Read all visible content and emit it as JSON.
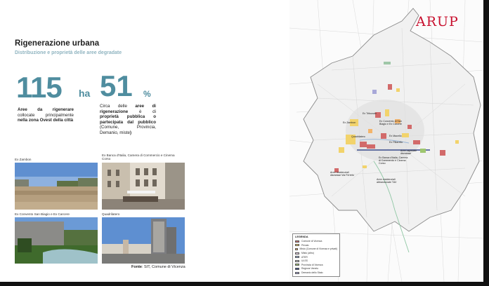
{
  "header": {
    "title": "Rigenerazione urbana",
    "subtitle": "Distribuzione e proprietà delle aree degradate"
  },
  "stats": {
    "area_value": "115",
    "area_unit": "ha",
    "area_desc_bold1": "Aree da rigenerare",
    "area_desc_plain": " collocate principalmente ",
    "area_desc_bold2": "nella zona Ovest della città",
    "pct_value": "51",
    "pct_unit": "%",
    "pct_desc_plain1": "Circa delle ",
    "pct_desc_bold1": "aree di rigenerazione",
    "pct_desc_plain2": " è di ",
    "pct_desc_bold2": "proprietà pubblica o partecipata dal pubblico",
    "pct_desc_plain3": " (Comune, Provincia, Demanio, miste",
    "pct_desc_close": ")"
  },
  "photos": [
    {
      "caption": "Ex Zambon"
    },
    {
      "caption": "Ex Banca d'Italia, Camera di Commercio e Cinema Corso"
    },
    {
      "caption": "Ex Convento San Biagio e Ex Carcere"
    },
    {
      "caption": "Quadrilatero"
    }
  ],
  "source": {
    "label": "Fonte",
    "text": ": SIT, Comune di Vicenza"
  },
  "map": {
    "logo": "ARUP",
    "legend_title": "LEGENDA",
    "legend": [
      {
        "label": "Comune di Vicenza",
        "color": "#d26a6a"
      },
      {
        "label": "Privato",
        "color": "#f2d36b"
      },
      {
        "label": "Misto (Comune di Vicenza e privati)",
        "color": "#f3b46b"
      },
      {
        "label": "Misto (altro)",
        "color": "#e6d0e6"
      },
      {
        "label": "ATER",
        "color": "#9fb4d8"
      },
      {
        "label": "ULSS",
        "color": "#c9c9c9"
      },
      {
        "label": "Provincia di Vicenza",
        "color": "#9ec66f"
      },
      {
        "label": "Regione Veneto",
        "color": "#3b4c8c"
      },
      {
        "label": "Demanio dello Stato",
        "color": "#a8a8d8"
      }
    ],
    "labels": [
      "Ex Tribunale",
      "Ex Zambon",
      "Ex Convento di San Biagio e Ex Carcere",
      "Quadrilatero",
      "Ex Macello",
      "Ex Pittarello",
      "Aree ospedale dismesse",
      "Ex Banca d'Italia, Camera di Commercio e Cinema Corso",
      "Aree residenziali dismesse Via Ferreto",
      "Aree residenziali abbandonate TAV"
    ]
  }
}
